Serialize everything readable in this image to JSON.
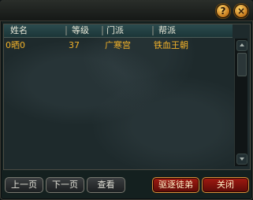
{
  "window": {
    "help_icon": "help-icon",
    "close_icon": "close-icon",
    "help_glyph": "?",
    "close_glyph": "×"
  },
  "table": {
    "headers": [
      "姓名",
      "等级",
      "门派",
      "帮派"
    ],
    "rows": [
      {
        "name": "0晒0",
        "level": "37",
        "sect": "广寒宫",
        "guild": "铁血王朝"
      }
    ]
  },
  "buttons": {
    "prev_page": "上一页",
    "next_page": "下一页",
    "view": "查看",
    "expel_disciple": "驱逐徒弟",
    "close": "关闭"
  },
  "colors": {
    "header_text": "#e8e8d8",
    "row_text": "#f2b22a",
    "accent_red": "#a21a11",
    "gold": "#d5913a"
  }
}
